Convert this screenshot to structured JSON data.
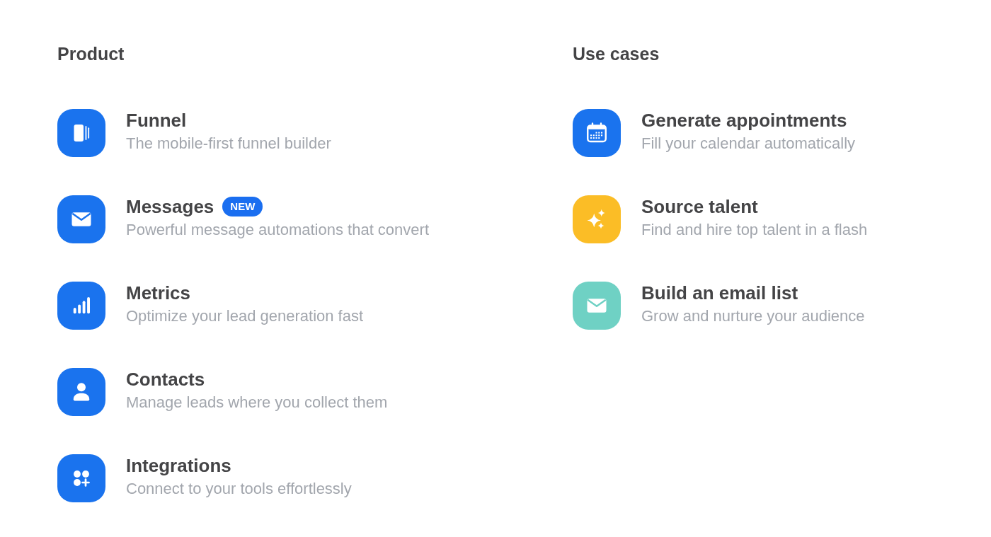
{
  "product": {
    "heading": "Product",
    "items": [
      {
        "title": "Funnel",
        "description": "The mobile-first funnel builder"
      },
      {
        "title": "Messages",
        "badge": "NEW",
        "description": "Powerful message automations that convert"
      },
      {
        "title": "Metrics",
        "description": "Optimize your lead generation fast"
      },
      {
        "title": "Contacts",
        "description": "Manage leads where you collect them"
      },
      {
        "title": "Integrations",
        "description": "Connect to your tools effortlessly"
      }
    ]
  },
  "use_cases": {
    "heading": "Use cases",
    "items": [
      {
        "title": "Generate appointments",
        "description": "Fill your calendar automatically",
        "color": "#1a73ee"
      },
      {
        "title": "Source talent",
        "description": "Find and hire top talent in a flash",
        "color": "#fbbd26"
      },
      {
        "title": "Build an email list",
        "description": "Grow and nurture your audience",
        "color": "#6fd1c4"
      }
    ]
  }
}
